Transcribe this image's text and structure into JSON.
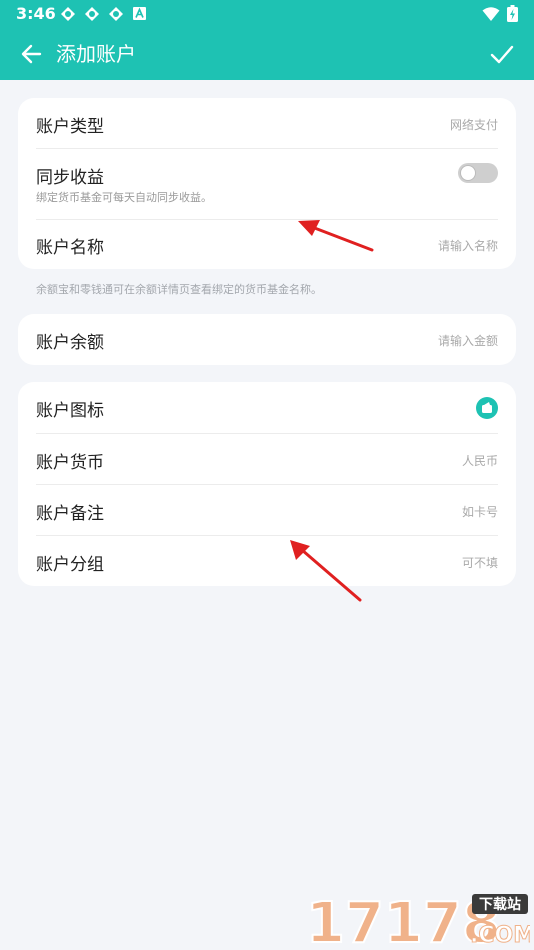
{
  "status": {
    "time": "3:46"
  },
  "appbar": {
    "title": "添加账户"
  },
  "card1": {
    "account_type_label": "账户类型",
    "account_type_value": "网络支付",
    "sync_label": "同步收益",
    "sync_sub": "绑定货币基金可每天自动同步收益。",
    "name_label": "账户名称",
    "name_placeholder": "请输入名称"
  },
  "note": "余额宝和零钱通可在余额详情页查看绑定的货币基金名称。",
  "card2": {
    "balance_label": "账户余额",
    "balance_placeholder": "请输入金额"
  },
  "card3": {
    "icon_label": "账户图标",
    "currency_label": "账户货币",
    "currency_value": "人民币",
    "remark_label": "账户备注",
    "remark_placeholder": "如卡号",
    "group_label": "账户分组",
    "group_placeholder": "可不填"
  },
  "colors": {
    "accent": "#1ec2b3",
    "background": "#f3f5f9",
    "arrow": "#e02020"
  },
  "watermark": {
    "brand": "17178",
    "tag": "下载站",
    "domain": ".COM"
  }
}
